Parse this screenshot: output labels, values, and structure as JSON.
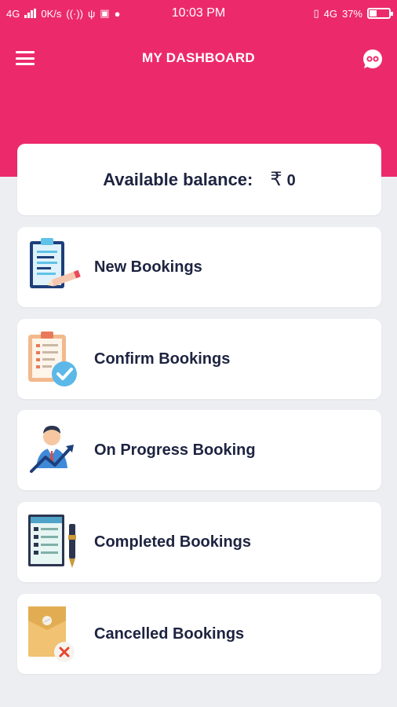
{
  "status_bar": {
    "network": "4G",
    "speed": "0K/s",
    "time": "10:03 PM",
    "network_right": "4G",
    "battery": "37%"
  },
  "header": {
    "title": "MY DASHBOARD"
  },
  "balance": {
    "label": "Available balance:",
    "currency": "₹",
    "amount": "0"
  },
  "menu": [
    {
      "label": "New Bookings",
      "icon": "new-booking-icon"
    },
    {
      "label": "Confirm Bookings",
      "icon": "confirm-booking-icon"
    },
    {
      "label": "On Progress Booking",
      "icon": "progress-booking-icon"
    },
    {
      "label": "Completed Bookings",
      "icon": "completed-booking-icon"
    },
    {
      "label": "Cancelled Bookings",
      "icon": "cancelled-booking-icon"
    }
  ],
  "colors": {
    "primary": "#ec2a6b",
    "background": "#eceef2",
    "text": "#1d2340"
  }
}
